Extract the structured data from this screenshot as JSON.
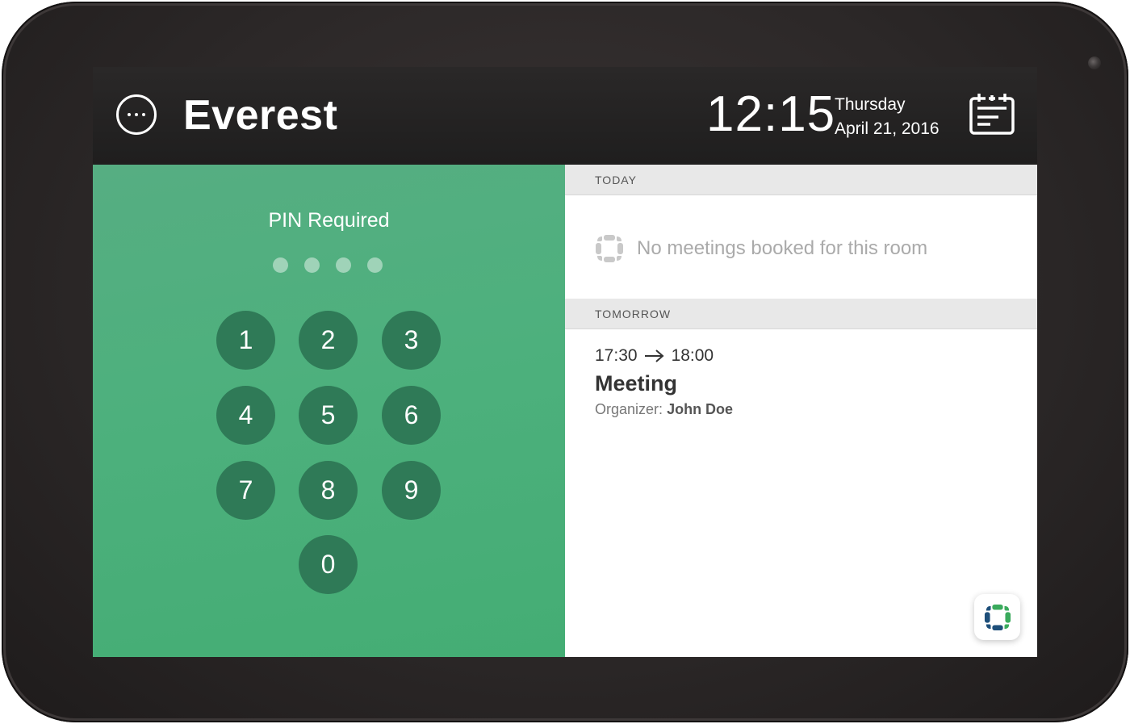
{
  "header": {
    "room_name": "Everest",
    "time": "12:15",
    "weekday": "Thursday",
    "date": "April 21, 2016"
  },
  "pin": {
    "title": "PIN Required",
    "entered_digits": 0,
    "length": 4,
    "keys": [
      "1",
      "2",
      "3",
      "4",
      "5",
      "6",
      "7",
      "8",
      "9",
      "0"
    ]
  },
  "schedule": {
    "today": {
      "label": "TODAY",
      "empty_message": "No meetings booked for this room"
    },
    "tomorrow": {
      "label": "TOMORROW",
      "meeting": {
        "start": "17:30",
        "end": "18:00",
        "title": "Meeting",
        "organizer_label": "Organizer:",
        "organizer_name": "John Doe"
      }
    }
  },
  "icons": {
    "menu": "more-horizontal-icon",
    "calendar": "calendar-icon",
    "logo": "app-logo-icon",
    "arrow": "arrow-right-icon"
  },
  "colors": {
    "header_bg": "#222020",
    "pin_panel_bg": "#4db07d",
    "keypad_key": "#2f7a57",
    "section_header_bg": "#e8e8e8",
    "logo_green": "#3aaa5c",
    "logo_blue": "#1e4f7a"
  }
}
